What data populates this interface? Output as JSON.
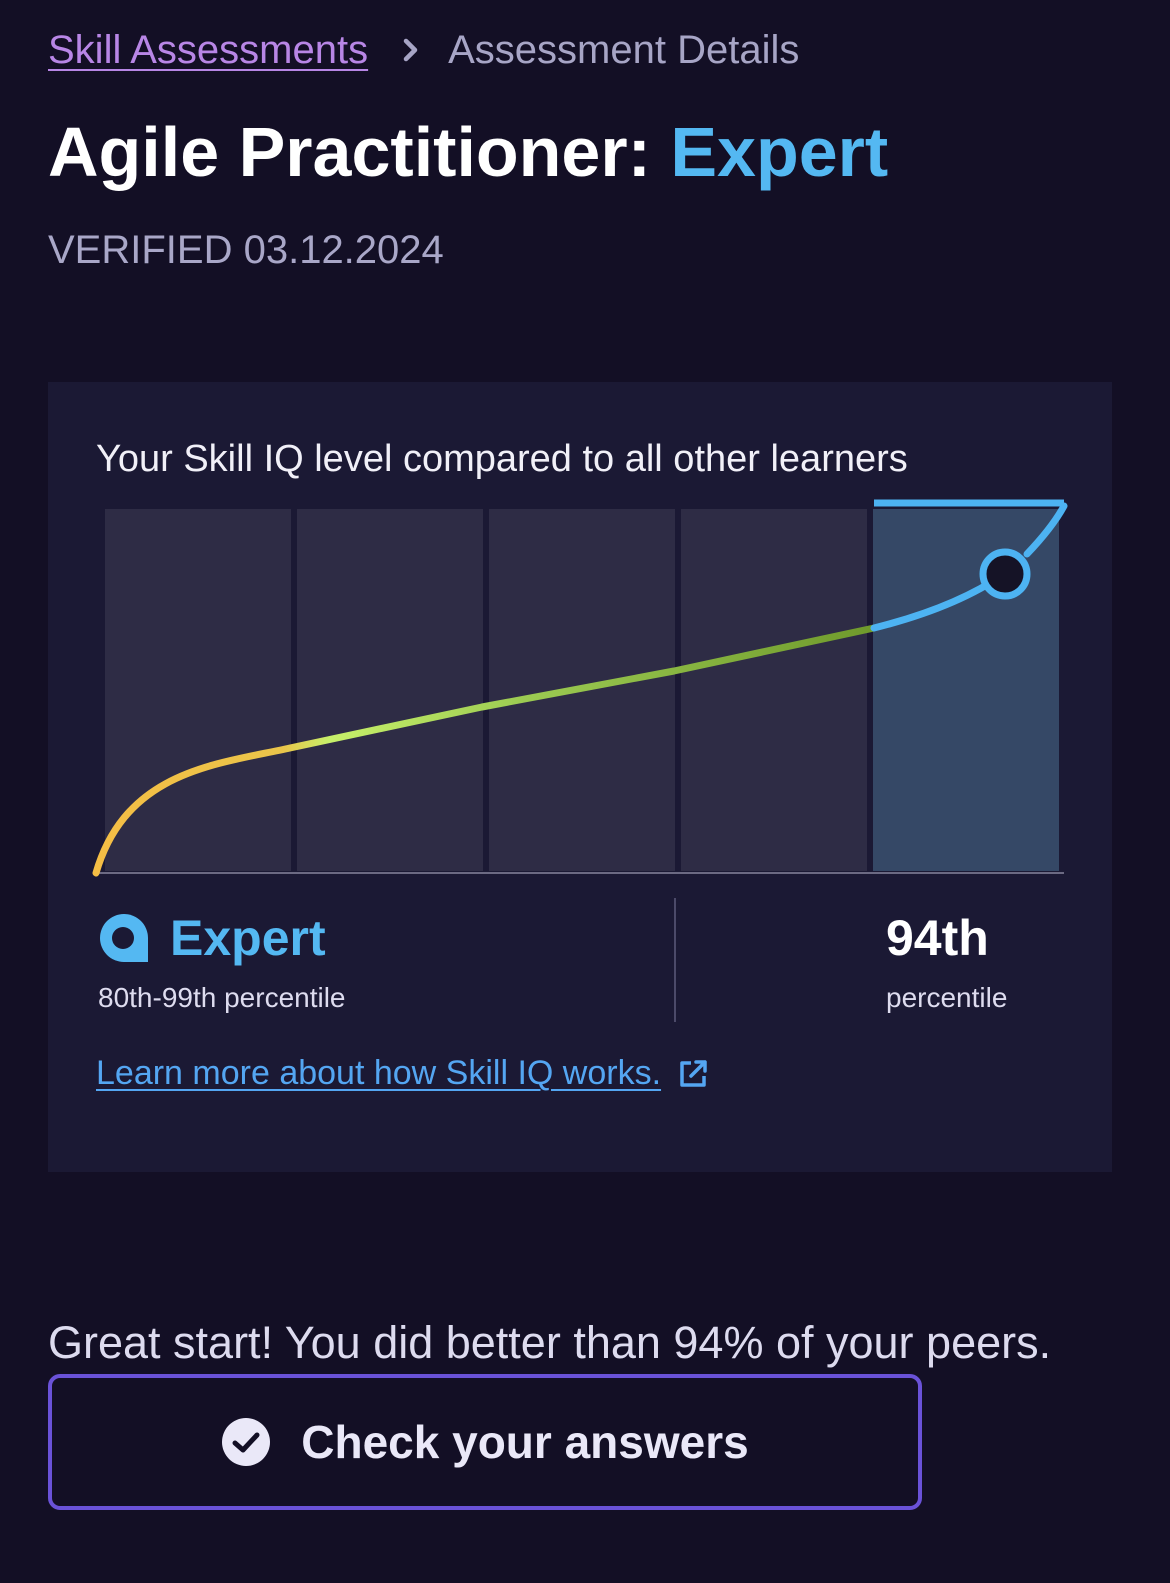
{
  "breadcrumb": {
    "parent_label": "Skill Assessments",
    "current_label": "Assessment Details"
  },
  "header": {
    "title_prefix": "Agile Practitioner:",
    "title_level": "Expert",
    "verified_text": "VERIFIED 03.12.2024"
  },
  "skill_card": {
    "heading": "Your Skill IQ level compared to all other learners",
    "level_name": "Expert",
    "level_range": "80th-99th percentile",
    "percentile_value": "94th",
    "percentile_label": "percentile",
    "learn_more": "Learn more about how Skill IQ works."
  },
  "summary": {
    "text": "Great start! You did better than 94% of your peers."
  },
  "actions": {
    "check_answers_label": "Check your answers"
  },
  "icons": {
    "breadcrumb_separator": "chevron-right-icon",
    "level_badge": "skill-iq-expert-icon",
    "external_link": "external-link-icon",
    "check": "check-circle-icon"
  },
  "colors": {
    "background": "#130f25",
    "card": "#1b1934",
    "accent_blue": "#54b8f2",
    "link_purple": "#b886e6",
    "button_border": "#6a52d8",
    "curve_start": "#f5be45",
    "curve_mid": "#c7f06a",
    "curve_end": "#6f9a2c"
  },
  "chart_data": {
    "type": "area",
    "bands": [
      {
        "level": 1,
        "active": false
      },
      {
        "level": 2,
        "active": false
      },
      {
        "level": 3,
        "active": false
      },
      {
        "level": 4,
        "active": false
      },
      {
        "level": 5,
        "active": true
      }
    ],
    "active_band_index": 4,
    "marker_percentile": 94,
    "grid": false,
    "legend": "none"
  }
}
